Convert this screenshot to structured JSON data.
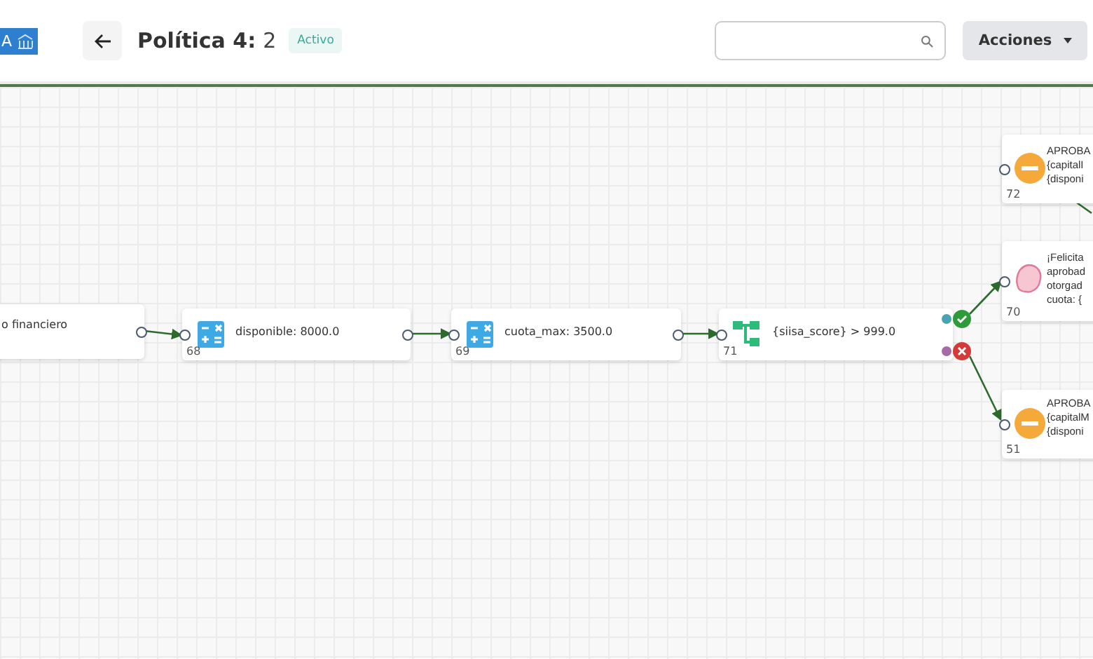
{
  "header": {
    "logo_text": "A",
    "title": "Política 4:",
    "version": "2",
    "status": "Activo",
    "actions_button": "Acciones"
  },
  "nodes": [
    {
      "kind": "text",
      "lines": [
        "o financiero"
      ]
    },
    {
      "kind": "calc",
      "number": "68",
      "lines": [
        "disponible: 8000.0"
      ]
    },
    {
      "kind": "calc",
      "number": "69",
      "lines": [
        "cuota_max: 3500.0"
      ]
    },
    {
      "kind": "condition",
      "number": "71",
      "lines": [
        "{siisa_score} > 999.0"
      ]
    },
    {
      "kind": "approve",
      "number": "72",
      "lines": [
        "APROBA",
        "{capitalI",
        "{disponi"
      ]
    },
    {
      "kind": "message",
      "number": "70",
      "lines": [
        "¡Felicita",
        "aprobad",
        "otorgad",
        "cuota: {"
      ]
    },
    {
      "kind": "approve",
      "number": "51",
      "lines": [
        "APROBA",
        "{capitalM",
        "{disponi"
      ]
    }
  ]
}
